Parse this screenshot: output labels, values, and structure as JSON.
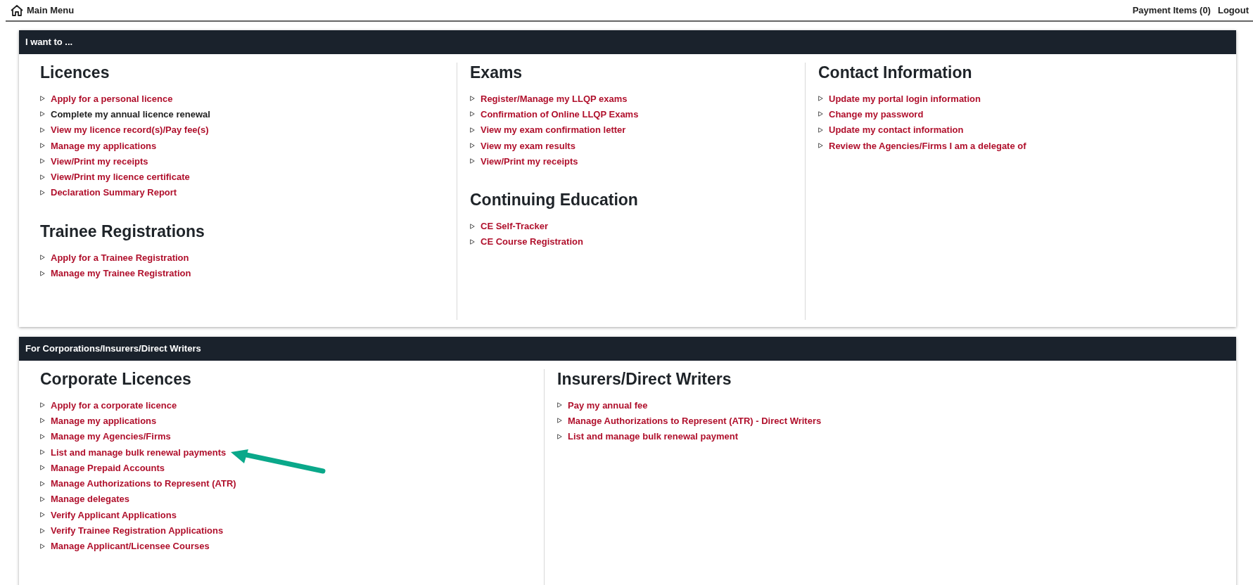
{
  "top_bar": {
    "title": "Main Menu",
    "links": [
      "Payment Items (0)",
      "Logout"
    ]
  },
  "panels": [
    {
      "title": "I want to ...",
      "columns": [
        [
          {
            "heading": "Licences",
            "items": [
              {
                "label": "Apply for a personal licence",
                "kind": "link"
              },
              {
                "label": "Complete my annual licence renewal",
                "kind": "plain"
              },
              {
                "label": "View my licence record(s)/Pay fee(s)",
                "kind": "link"
              },
              {
                "label": "Manage my applications",
                "kind": "link"
              },
              {
                "label": "View/Print my receipts",
                "kind": "link"
              },
              {
                "label": "View/Print my licence certificate",
                "kind": "link"
              },
              {
                "label": "Declaration Summary Report",
                "kind": "link"
              }
            ]
          },
          {
            "heading": "Trainee Registrations",
            "items": [
              {
                "label": "Apply for a Trainee Registration",
                "kind": "link"
              },
              {
                "label": "Manage my Trainee Registration",
                "kind": "link"
              }
            ]
          }
        ],
        [
          {
            "heading": "Exams",
            "items": [
              {
                "label": "Register/Manage my LLQP exams",
                "kind": "link"
              },
              {
                "label": "Confirmation of Online LLQP Exams",
                "kind": "link"
              },
              {
                "label": "View my exam confirmation letter",
                "kind": "link"
              },
              {
                "label": "View my exam results",
                "kind": "link"
              },
              {
                "label": "View/Print my receipts",
                "kind": "link"
              }
            ]
          },
          {
            "heading": "Continuing Education",
            "items": [
              {
                "label": "CE Self-Tracker",
                "kind": "link"
              },
              {
                "label": "CE Course Registration",
                "kind": "link"
              }
            ]
          }
        ],
        [
          {
            "heading": "Contact Information",
            "items": [
              {
                "label": "Update my portal login information",
                "kind": "link"
              },
              {
                "label": "Change my password",
                "kind": "link"
              },
              {
                "label": "Update my contact information",
                "kind": "link"
              },
              {
                "label": "Review the Agencies/Firms I am a delegate of",
                "kind": "link"
              }
            ]
          }
        ]
      ]
    },
    {
      "title": "For Corporations/Insurers/Direct Writers",
      "columns": [
        [
          {
            "heading": "Corporate Licences",
            "items": [
              {
                "label": "Apply for a corporate licence",
                "kind": "link"
              },
              {
                "label": "Manage my applications",
                "kind": "link"
              },
              {
                "label": "Manage my Agencies/Firms",
                "kind": "link"
              },
              {
                "label": "List and manage bulk renewal payments",
                "kind": "link",
                "annotated": true
              },
              {
                "label": "Manage Prepaid Accounts",
                "kind": "link"
              },
              {
                "label": "Manage Authorizations to Represent (ATR)",
                "kind": "link"
              },
              {
                "label": "Manage delegates",
                "kind": "link"
              },
              {
                "label": "Verify Applicant Applications",
                "kind": "link"
              },
              {
                "label": "Verify Trainee Registration Applications",
                "kind": "link"
              },
              {
                "label": "Manage Applicant/Licensee Courses",
                "kind": "link"
              }
            ]
          }
        ],
        [
          {
            "heading": "Insurers/Direct Writers",
            "items": [
              {
                "label": "Pay my annual fee",
                "kind": "link"
              },
              {
                "label": "Manage Authorizations to Represent (ATR) - Direct Writers",
                "kind": "link"
              },
              {
                "label": "List and manage bulk renewal payment",
                "kind": "link"
              }
            ]
          }
        ]
      ]
    }
  ]
}
